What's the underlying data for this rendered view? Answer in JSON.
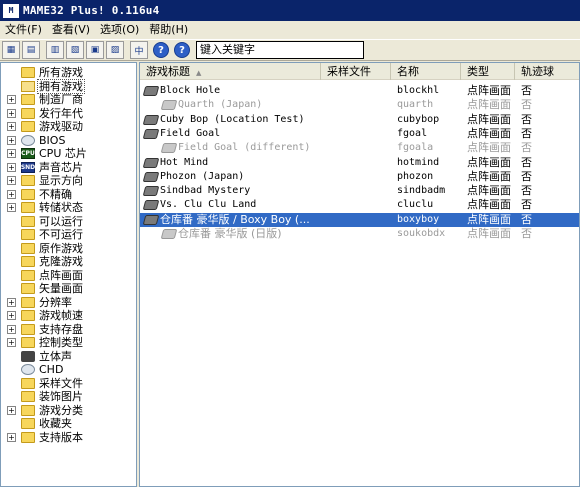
{
  "window": {
    "title": "MAME32 Plus! 0.116u4",
    "icon": "mame-icon"
  },
  "menu": [
    "文件(F)",
    "查看(V)",
    "选项(O)",
    "帮助(H)"
  ],
  "toolbar": {
    "buttons": [
      "view-icons-large",
      "view-icons-small",
      "view-list",
      "view-details",
      "view-grouped"
    ],
    "fullscreen_label": "中",
    "help_buttons": [
      "?",
      "?"
    ],
    "search_value": "键入关键字"
  },
  "tree": [
    {
      "label": "所有游戏",
      "icon": "folder-icon",
      "expandable": false
    },
    {
      "label": "拥有游戏",
      "icon": "folder-open-icon",
      "expandable": false,
      "selected": true
    },
    {
      "label": "制造厂商",
      "icon": "folder-icon",
      "expandable": true
    },
    {
      "label": "发行年代",
      "icon": "folder-icon",
      "expandable": true
    },
    {
      "label": "游戏驱动",
      "icon": "folder-icon",
      "expandable": true
    },
    {
      "label": "BIOS",
      "icon": "cd-icon",
      "expandable": true
    },
    {
      "label": "CPU 芯片",
      "icon": "cpu-chip-icon",
      "expandable": true
    },
    {
      "label": "声音芯片",
      "icon": "sound-chip-icon",
      "expandable": true
    },
    {
      "label": "显示方向",
      "icon": "folder-icon",
      "expandable": true
    },
    {
      "label": "不精确",
      "icon": "folder-icon",
      "expandable": true
    },
    {
      "label": "转储状态",
      "icon": "folder-icon",
      "expandable": true
    },
    {
      "label": "可以运行",
      "icon": "folder-icon",
      "expandable": false
    },
    {
      "label": "不可运行",
      "icon": "folder-icon",
      "expandable": false
    },
    {
      "label": "原作游戏",
      "icon": "folder-icon",
      "expandable": false
    },
    {
      "label": "克隆游戏",
      "icon": "folder-icon",
      "expandable": false
    },
    {
      "label": "点阵画面",
      "icon": "folder-icon",
      "expandable": false
    },
    {
      "label": "矢量画面",
      "icon": "folder-icon",
      "expandable": false
    },
    {
      "label": "分辨率",
      "icon": "folder-icon",
      "expandable": true
    },
    {
      "label": "游戏帧速",
      "icon": "folder-icon",
      "expandable": true
    },
    {
      "label": "支持存盘",
      "icon": "folder-icon",
      "expandable": true
    },
    {
      "label": "控制类型",
      "icon": "folder-icon",
      "expandable": true
    },
    {
      "label": "立体声",
      "icon": "speaker-icon",
      "expandable": false
    },
    {
      "label": "CHD",
      "icon": "cd-icon",
      "expandable": false
    },
    {
      "label": "采样文件",
      "icon": "folder-icon",
      "expandable": false
    },
    {
      "label": "装饰图片",
      "icon": "folder-icon",
      "expandable": false
    },
    {
      "label": "游戏分类",
      "icon": "folder-icon",
      "expandable": true
    },
    {
      "label": "收藏夹",
      "icon": "folder-icon",
      "expandable": false
    },
    {
      "label": "支持版本",
      "icon": "folder-icon",
      "expandable": true
    }
  ],
  "list": {
    "columns": [
      "游戏标题",
      "采样文件",
      "名称",
      "类型",
      "轨迹球"
    ],
    "rows": [
      {
        "title": "Block Hole",
        "sample": "",
        "name": "blockhl",
        "type": "点阵画面",
        "trackball": "否",
        "clone": false,
        "selected": false
      },
      {
        "title": "Quarth (Japan)",
        "sample": "",
        "name": "quarth",
        "type": "点阵画面",
        "trackball": "否",
        "clone": true,
        "selected": false
      },
      {
        "title": "Cuby Bop (Location Test)",
        "sample": "",
        "name": "cubybop",
        "type": "点阵画面",
        "trackball": "否",
        "clone": false,
        "selected": false
      },
      {
        "title": "Field Goal",
        "sample": "",
        "name": "fgoal",
        "type": "点阵画面",
        "trackball": "否",
        "clone": false,
        "selected": false
      },
      {
        "title": "Field Goal (different)",
        "sample": "",
        "name": "fgoala",
        "type": "点阵画面",
        "trackball": "否",
        "clone": true,
        "selected": false
      },
      {
        "title": "Hot Mind",
        "sample": "",
        "name": "hotmind",
        "type": "点阵画面",
        "trackball": "否",
        "clone": false,
        "selected": false
      },
      {
        "title": "Phozon (Japan)",
        "sample": "",
        "name": "phozon",
        "type": "点阵画面",
        "trackball": "否",
        "clone": false,
        "selected": false
      },
      {
        "title": "Sindbad Mystery",
        "sample": "",
        "name": "sindbadm",
        "type": "点阵画面",
        "trackball": "否",
        "clone": false,
        "selected": false
      },
      {
        "title": "Vs. Clu Clu Land",
        "sample": "",
        "name": "cluclu",
        "type": "点阵画面",
        "trackball": "否",
        "clone": false,
        "selected": false
      },
      {
        "title": "仓库番 豪华版 / Boxy Boy (...",
        "sample": "",
        "name": "boxyboy",
        "type": "点阵画面",
        "trackball": "否",
        "clone": false,
        "selected": true
      },
      {
        "title": "仓库番 豪华版 (日版)",
        "sample": "",
        "name": "soukobdx",
        "type": "点阵画面",
        "trackball": "否",
        "clone": true,
        "selected": false
      }
    ]
  }
}
